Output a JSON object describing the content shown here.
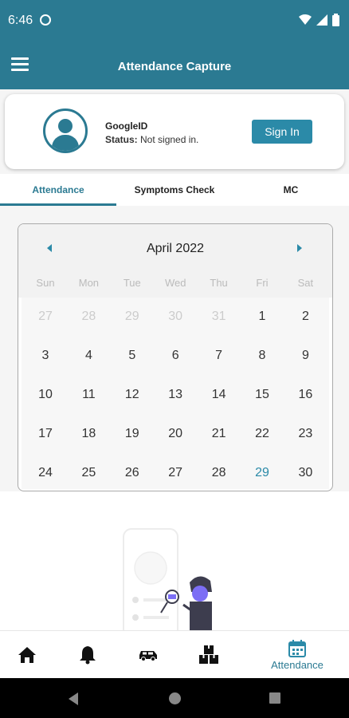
{
  "status_bar": {
    "time": "6:46"
  },
  "app_bar": {
    "title": "Attendance Capture"
  },
  "profile": {
    "id_label": "GoogleID",
    "status_label": "Status:",
    "status_value": "Not signed in.",
    "sign_in_label": "Sign In"
  },
  "tabs": [
    "Attendance",
    "Symptoms Check",
    "MC"
  ],
  "calendar": {
    "month_label": "April 2022",
    "weekdays": [
      "Sun",
      "Mon",
      "Tue",
      "Wed",
      "Thu",
      "Fri",
      "Sat"
    ],
    "weeks": [
      [
        "27",
        "28",
        "29",
        "30",
        "31",
        "1",
        "2"
      ],
      [
        "3",
        "4",
        "5",
        "6",
        "7",
        "8",
        "9"
      ],
      [
        "10",
        "11",
        "12",
        "13",
        "14",
        "15",
        "16"
      ],
      [
        "17",
        "18",
        "19",
        "20",
        "21",
        "22",
        "23"
      ],
      [
        "24",
        "25",
        "26",
        "27",
        "28",
        "29",
        "30"
      ]
    ],
    "outside_month_count": 5,
    "today": "29"
  },
  "bottom_nav": {
    "items": [
      "home-icon",
      "bell-icon",
      "car-icon",
      "boxes-icon",
      "calendar-icon"
    ],
    "active_label": "Attendance"
  },
  "colors": {
    "primary": "#2b7a92",
    "accent": "#2b8aa8",
    "illustration": "#7c6ef5"
  }
}
